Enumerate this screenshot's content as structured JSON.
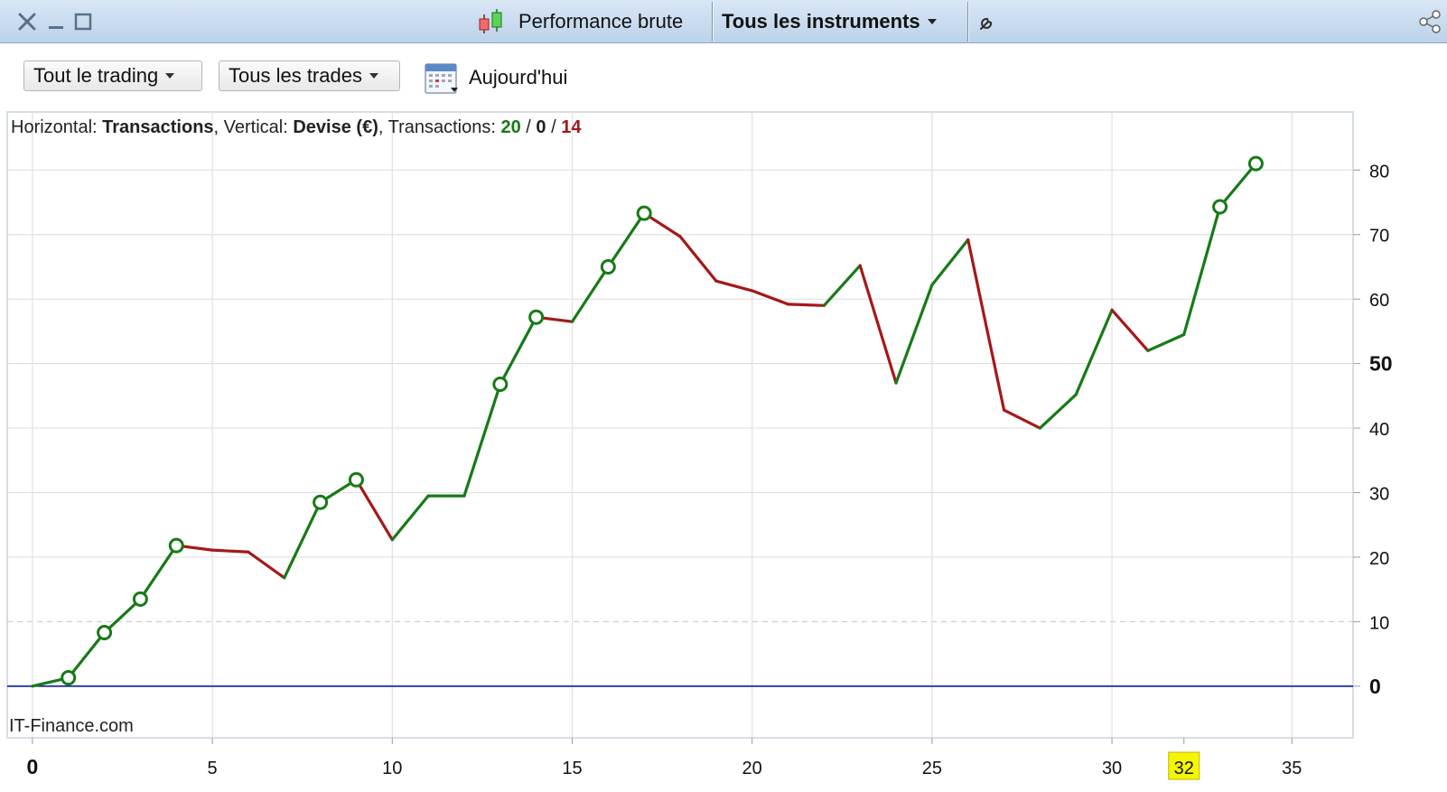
{
  "window": {
    "close_icon": "close-icon",
    "minimize_icon": "minimize-icon",
    "maximize_icon": "maximize-icon",
    "view_label": "Performance brute",
    "instrument_label": "Tous les instruments",
    "settings_icon": "wrench-icon",
    "share_icon": "share-icon"
  },
  "toolbar": {
    "trading_filter": "Tout le trading",
    "trades_filter": "Tous les trades",
    "date_icon": "calendar-icon",
    "date_label": "Aujourd'hui"
  },
  "info": {
    "h_label": "Horizontal: ",
    "h_value": "Transactions",
    "sep1": ", Vertical: ",
    "v_value": "Devise (€)",
    "sep2": ", Transactions: ",
    "wins": "20",
    "slash1": " / ",
    "neutral": "0",
    "slash2": " / ",
    "losses": "14"
  },
  "watermark": "IT-Finance.com",
  "colors": {
    "gain": "#177a17",
    "loss": "#a51818",
    "zero_line": "#0b1f9e",
    "highlight": "#f5f500"
  },
  "chart_data": {
    "type": "line",
    "xlabel": "Transactions",
    "ylabel": "Devise (€)",
    "xlim": [
      -0.7,
      36.7
    ],
    "ylim": [
      -8,
      89
    ],
    "x_ticks": [
      0,
      5,
      10,
      15,
      20,
      25,
      30,
      32,
      35
    ],
    "y_ticks": [
      0,
      10,
      20,
      30,
      40,
      50,
      60,
      70,
      80
    ],
    "highlight_x": 32,
    "bold_y_ticks": [
      0,
      50
    ],
    "x": [
      0,
      1,
      2,
      3,
      4,
      5,
      6,
      7,
      8,
      9,
      10,
      11,
      12,
      13,
      14,
      15,
      16,
      17,
      18,
      19,
      20,
      21,
      22,
      23,
      24,
      25,
      26,
      27,
      28,
      29,
      30,
      31,
      32,
      33,
      34
    ],
    "values": [
      0,
      1.3,
      8.3,
      13.5,
      21.8,
      21.1,
      20.8,
      16.8,
      28.5,
      32,
      22.7,
      29.5,
      29.5,
      46.8,
      57.2,
      56.5,
      65,
      73.3,
      69.7,
      62.8,
      61.3,
      59.2,
      59,
      65.2,
      47,
      62.2,
      69.2,
      42.8,
      40,
      45.2,
      58.3,
      52,
      54.5,
      74.3,
      81
    ],
    "new_high_points": [
      1,
      2,
      3,
      4,
      8,
      9,
      13,
      14,
      16,
      17,
      33,
      34
    ]
  }
}
